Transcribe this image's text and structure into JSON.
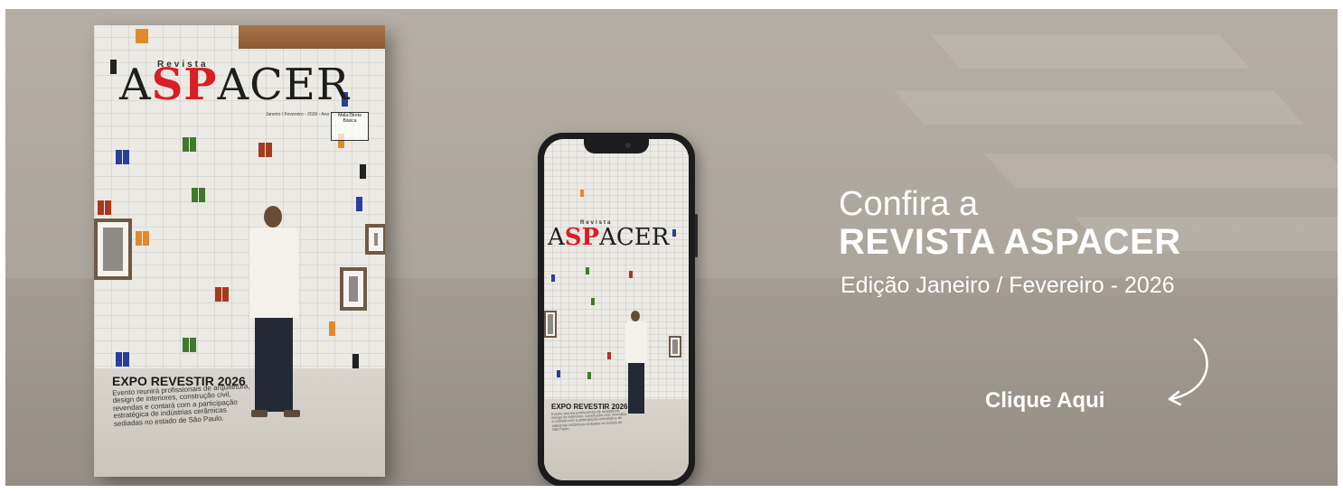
{
  "banner": {
    "headline_line1": "Confira a",
    "headline_line2": "REVISTA ASPACER",
    "edition": "Edição Janeiro / Fevereiro - 2026",
    "cta_label": "Clique Aqui",
    "colors": {
      "background": "#aca59c",
      "text": "#ffffff",
      "logo_red": "#d81e26"
    }
  },
  "magazine": {
    "logo_prefix": "Revista",
    "logo_a": "A",
    "logo_sp": "SP",
    "logo_rest": "ACER",
    "edition_line": "Janeiro / Fevereiro - 2026 - Ano XVIII nº 149",
    "box_line1": "Mala Direta",
    "box_line2": "Básica",
    "cover_title": "EXPO REVESTIR 2026",
    "cover_text": "Evento reunirá profissionais de arquitetura, design de interiores, construção civil, revendas e contará com a participação estratégica de indústrias cerâmicas sediadas no estado de São Paulo."
  },
  "phone": {
    "logo_prefix": "Revista",
    "logo_a": "A",
    "logo_sp": "SP",
    "logo_rest": "ACER",
    "cover_title": "EXPO REVESTIR 2026",
    "cover_text": "Evento reunirá profissionais de arquitetura, design de interiores, construção civil, revendas e contará com a participação estratégica de indústrias cerâmicas sediadas no estado de São Paulo."
  }
}
